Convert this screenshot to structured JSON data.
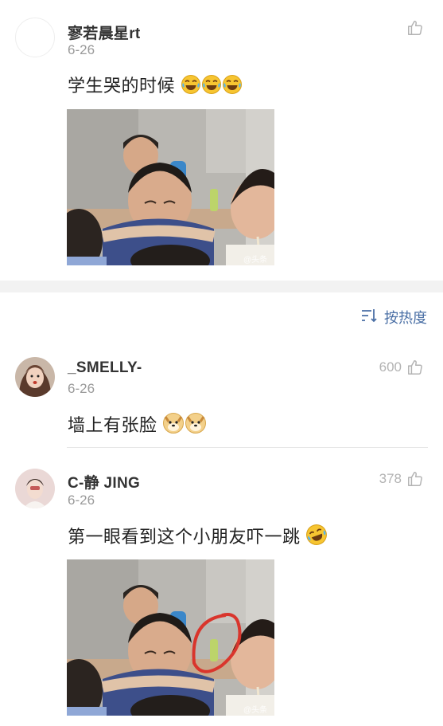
{
  "posts": [
    {
      "username": "寥若晨星rt",
      "date": "6-26",
      "text": "学生哭的时候",
      "emoji": [
        "laugh-cry",
        "laugh-cry",
        "laugh-cry"
      ],
      "image_watermark": "@头条"
    }
  ],
  "sort": {
    "label": "按热度"
  },
  "comments": [
    {
      "username": "_SMELLY-",
      "date": "6-26",
      "likes": "600",
      "text": "墙上有张脸",
      "emoji": [
        "doge",
        "doge"
      ]
    },
    {
      "username": "C-静 JING",
      "date": "6-26",
      "likes": "378",
      "text": "第一眼看到这个小朋友吓一跳",
      "emoji": [
        "laugh-cry-tilt"
      ],
      "image_watermark": "@头条"
    }
  ],
  "colors": {
    "accent": "#4a6fa5",
    "muted": "#9a9a9a",
    "divider": "#e6e6e6",
    "band": "#f2f2f2",
    "circle": "#d9352c"
  },
  "icons": [
    "thumb-up-icon",
    "sort-icon",
    "laugh-cry-emoji-icon",
    "doge-emoji-icon"
  ]
}
